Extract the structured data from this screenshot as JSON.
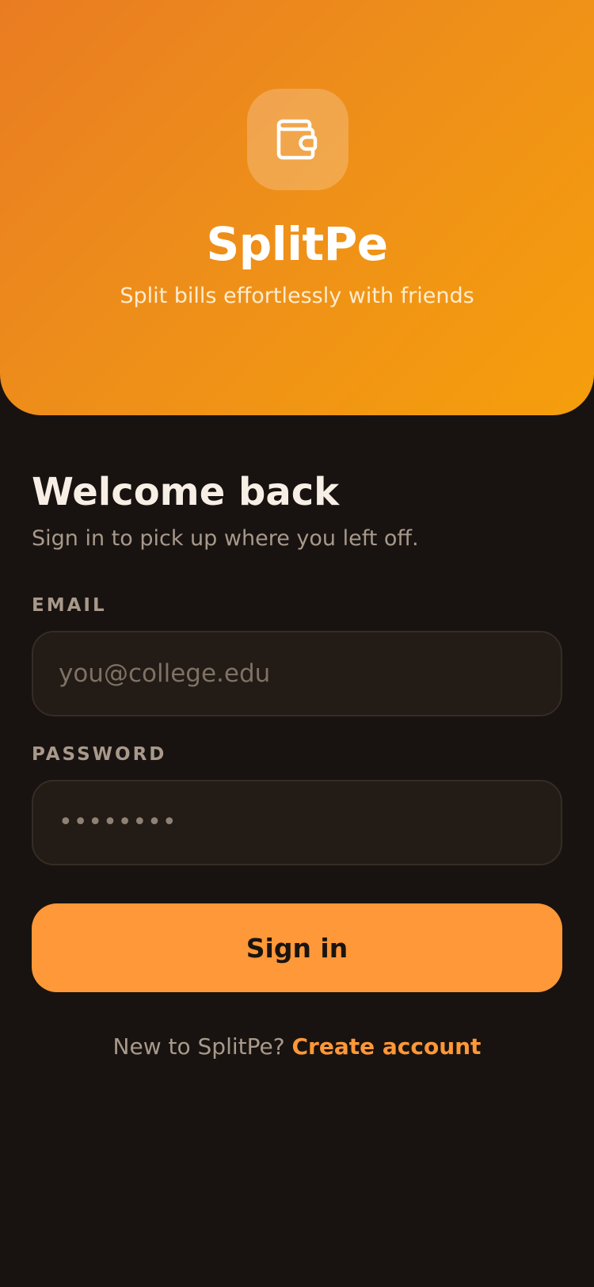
{
  "header": {
    "icon": "wallet-icon",
    "app_name": "SplitPe",
    "tagline": "Split bills effortlessly with friends",
    "gradient_colors": [
      "#e97c22",
      "#f59e0c"
    ]
  },
  "login": {
    "title": "Welcome back",
    "subtitle": "Sign in to pick up where you left off.",
    "email_label": "EMAIL",
    "email_placeholder": "you@college.edu",
    "email_value": "",
    "password_label": "PASSWORD",
    "password_masked": "••••••••",
    "submit_label": "Sign in",
    "footer_prompt": "New to SplitPe?",
    "footer_link": "Create account"
  },
  "colors": {
    "background": "#181310",
    "accent": "#ff9838",
    "input_bg": "#221b16"
  }
}
